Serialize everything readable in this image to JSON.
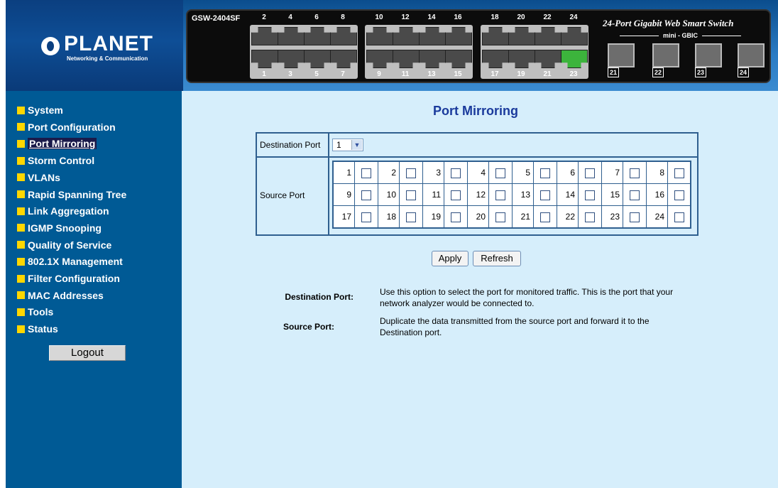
{
  "header": {
    "logo_text": "PLANET",
    "logo_sub": "Networking & Communication",
    "model": "GSW-2404SF",
    "device_title": "24-Port Gigabit Web Smart Switch",
    "mini_gbic": "mini - GBIC",
    "top_port_numbers": [
      "2",
      "4",
      "6",
      "8",
      "10",
      "12",
      "14",
      "16",
      "18",
      "20",
      "22",
      "24"
    ],
    "bottom_port_numbers": [
      "1",
      "3",
      "5",
      "7",
      "9",
      "11",
      "13",
      "15",
      "17",
      "19",
      "21",
      "23"
    ],
    "active_port": "23",
    "sfp_numbers": [
      "21",
      "22",
      "23",
      "24"
    ]
  },
  "sidebar": {
    "items": [
      {
        "label": "System"
      },
      {
        "label": "Port Configuration"
      },
      {
        "label": "Port Mirroring",
        "selected": true
      },
      {
        "label": "Storm Control"
      },
      {
        "label": "VLANs"
      },
      {
        "label": "Rapid Spanning Tree"
      },
      {
        "label": "Link Aggregation"
      },
      {
        "label": "IGMP Snooping"
      },
      {
        "label": "Quality of Service"
      },
      {
        "label": "802.1X Management"
      },
      {
        "label": "Filter Configuration"
      },
      {
        "label": "MAC Addresses"
      },
      {
        "label": "Tools"
      },
      {
        "label": "Status"
      }
    ],
    "logout_label": "Logout"
  },
  "main": {
    "title": "Port Mirroring",
    "destination_label": "Destination Port",
    "destination_value": "1",
    "source_label": "Source Port",
    "source_ports": [
      "1",
      "2",
      "3",
      "4",
      "5",
      "6",
      "7",
      "8",
      "9",
      "10",
      "11",
      "12",
      "13",
      "14",
      "15",
      "16",
      "17",
      "18",
      "19",
      "20",
      "21",
      "22",
      "23",
      "24"
    ],
    "apply_label": "Apply",
    "refresh_label": "Refresh",
    "help": [
      {
        "term": "Destination Port:",
        "desc": "Use this option to select the port for monitored traffic. This is the port that your network analyzer would be connected to."
      },
      {
        "term": "Source Port:",
        "desc": "Duplicate the data transmitted from the source port and forward it to the Destination port."
      }
    ]
  },
  "colors": {
    "sidebar_bg": "#005a95",
    "content_bg": "#d6eefb",
    "title_color": "#1a3a9c",
    "nav_bullet": "#ffd700"
  }
}
